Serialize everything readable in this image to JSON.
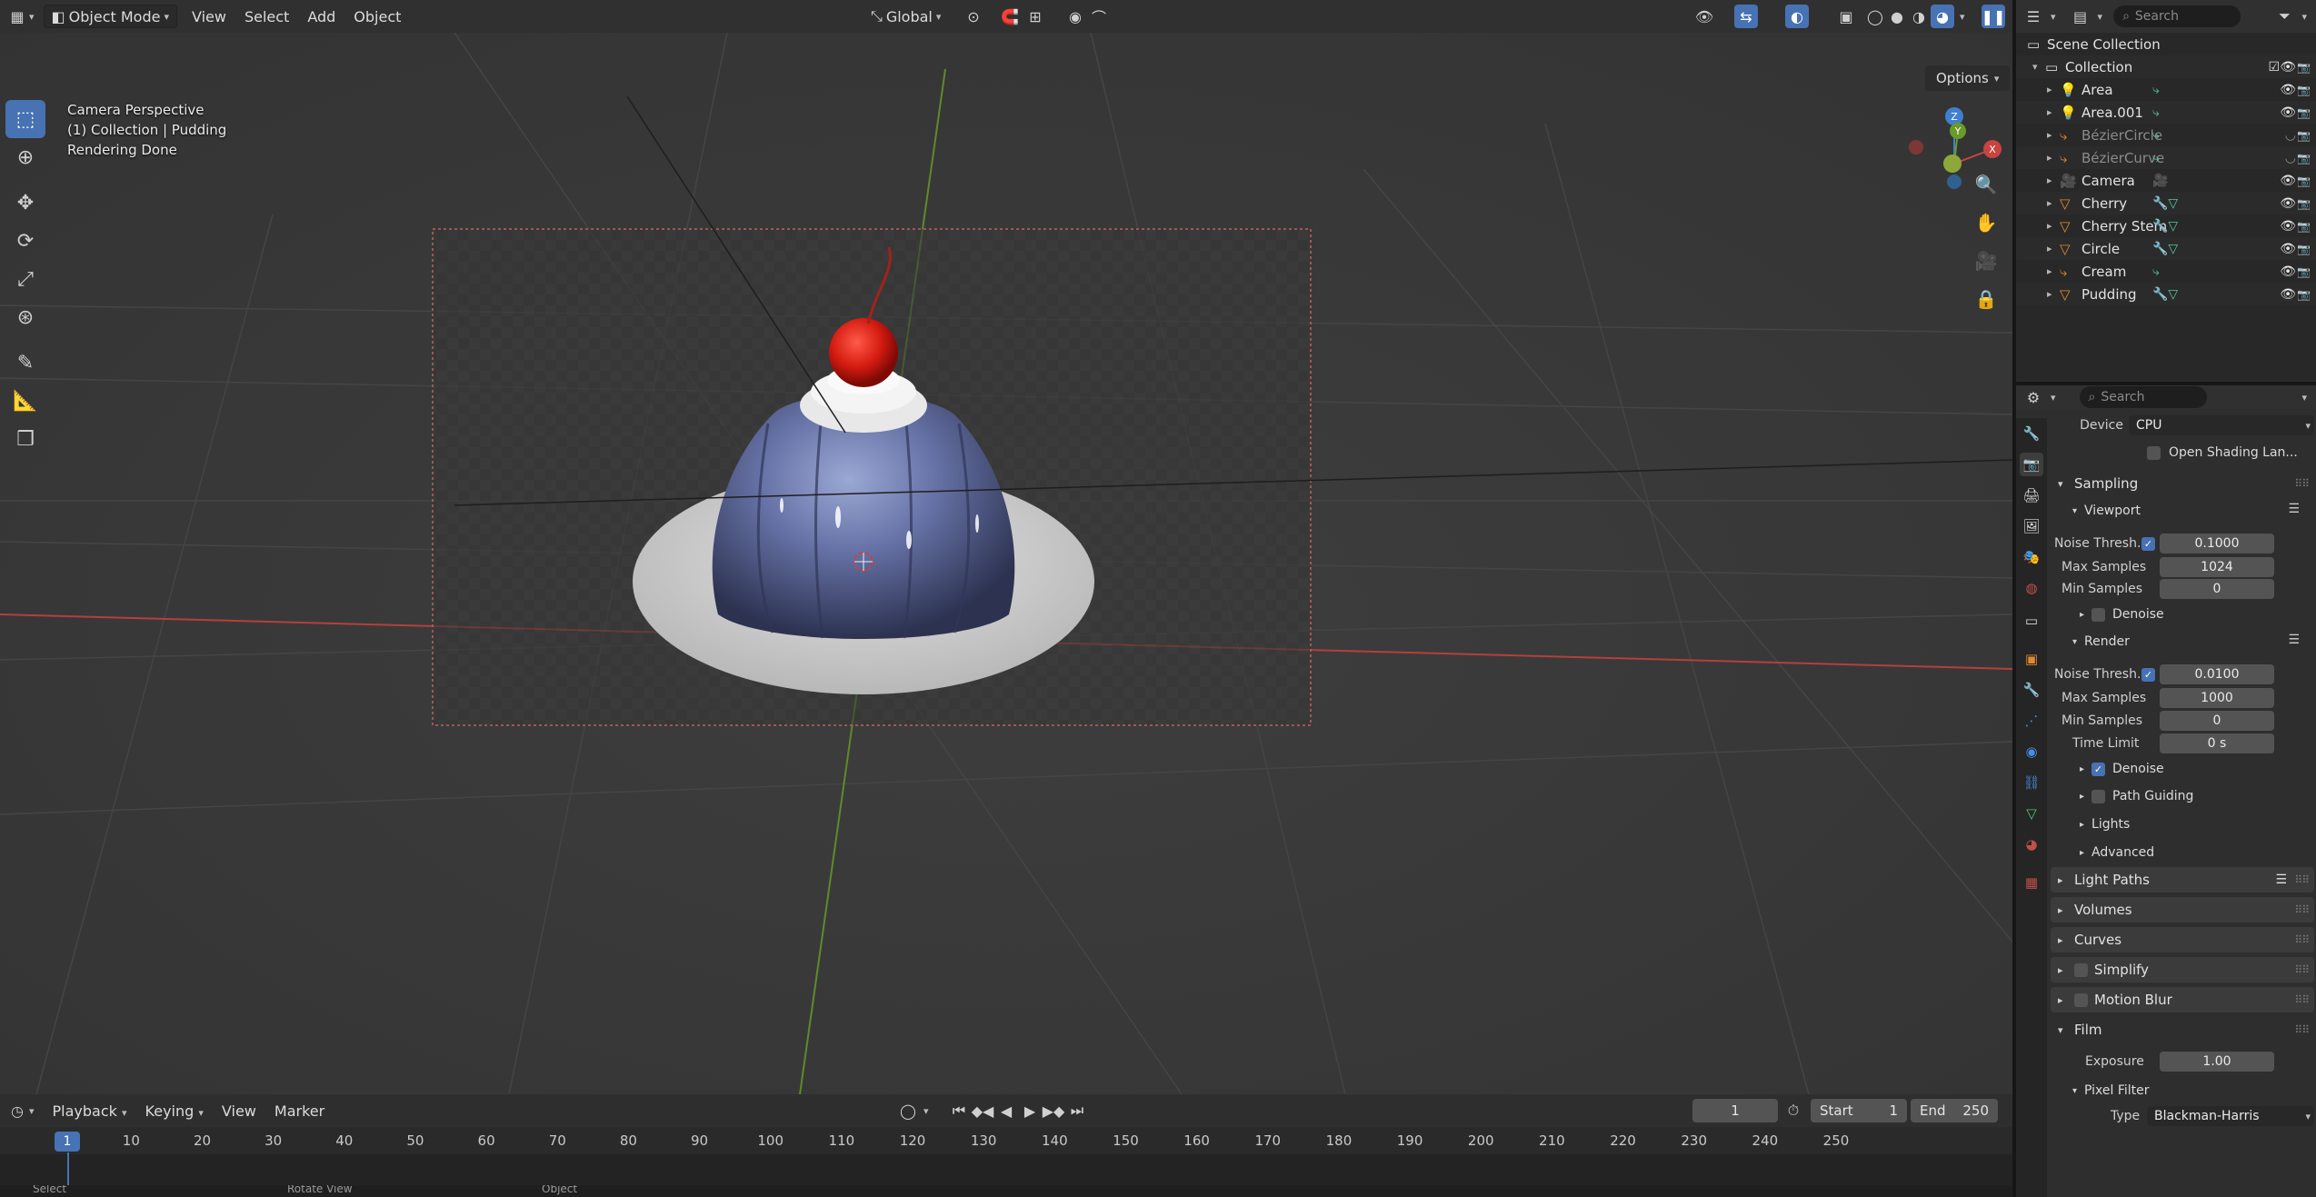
{
  "viewport_header": {
    "mode": "Object Mode",
    "menus": [
      "View",
      "Select",
      "Add",
      "Object"
    ],
    "transform_orientation": "Global",
    "options_label": "Options"
  },
  "viewport_overlay": {
    "line1": "Camera Perspective",
    "line2": "(1) Collection | Pudding",
    "line3": "Rendering Done"
  },
  "gizmo": {
    "z": "Z",
    "y": "Y",
    "x": "X"
  },
  "timeline": {
    "menus": [
      "Playback",
      "Keying",
      "View",
      "Marker"
    ],
    "current_frame": "1",
    "start_label": "Start",
    "start_value": "1",
    "end_label": "End",
    "end_value": "250",
    "ticks": [
      "10",
      "20",
      "30",
      "40",
      "50",
      "60",
      "70",
      "80",
      "90",
      "100",
      "110",
      "120",
      "130",
      "140",
      "150",
      "160",
      "170",
      "180",
      "190",
      "200",
      "210",
      "220",
      "230",
      "240",
      "250"
    ],
    "cursor_label": "1"
  },
  "status_bar": {
    "left": "Select",
    "middle": "Rotate View",
    "right": "Object"
  },
  "outliner": {
    "search_placeholder": "Search",
    "scene_collection": "Scene Collection",
    "collection": "Collection",
    "items": [
      {
        "name": "Area",
        "type": "light",
        "dim": false
      },
      {
        "name": "Area.001",
        "type": "light",
        "dim": false
      },
      {
        "name": "BézierCircle",
        "type": "curve",
        "dim": true
      },
      {
        "name": "BézierCurve",
        "type": "curve",
        "dim": true
      },
      {
        "name": "Camera",
        "type": "camera",
        "dim": false
      },
      {
        "name": "Cherry",
        "type": "mesh",
        "dim": false
      },
      {
        "name": "Cherry Stem",
        "type": "mesh",
        "dim": false
      },
      {
        "name": "Circle",
        "type": "mesh",
        "dim": false
      },
      {
        "name": "Cream",
        "type": "curve",
        "dim": false
      },
      {
        "name": "Pudding",
        "type": "mesh",
        "dim": false
      }
    ]
  },
  "properties": {
    "search_placeholder": "Search",
    "device_label": "Device",
    "device_value": "CPU",
    "osl_label": "Open Shading Lan...",
    "sampling": "Sampling",
    "viewport": "Viewport",
    "vp_noise_label": "Noise Thresh...",
    "vp_noise_value": "0.1000",
    "vp_max_label": "Max Samples",
    "vp_max_value": "1024",
    "vp_min_label": "Min Samples",
    "vp_min_value": "0",
    "vp_denoise": "Denoise",
    "render": "Render",
    "r_noise_label": "Noise Thresh...",
    "r_noise_value": "0.0100",
    "r_max_label": "Max Samples",
    "r_max_value": "1000",
    "r_min_label": "Min Samples",
    "r_min_value": "0",
    "r_time_label": "Time Limit",
    "r_time_value": "0 s",
    "r_denoise": "Denoise",
    "path_guiding": "Path Guiding",
    "lights": "Lights",
    "advanced": "Advanced",
    "light_paths": "Light Paths",
    "volumes": "Volumes",
    "curves": "Curves",
    "simplify": "Simplify",
    "motion_blur": "Motion Blur",
    "film": "Film",
    "exposure_label": "Exposure",
    "exposure_value": "1.00",
    "pixel_filter": "Pixel Filter",
    "type_label": "Type",
    "type_value": "Blackman-Harris"
  },
  "colors": {
    "accent": "#4772b3",
    "x_axis": "#c8443f",
    "y_axis": "#6a9a2a",
    "z_axis": "#3f7fce"
  }
}
